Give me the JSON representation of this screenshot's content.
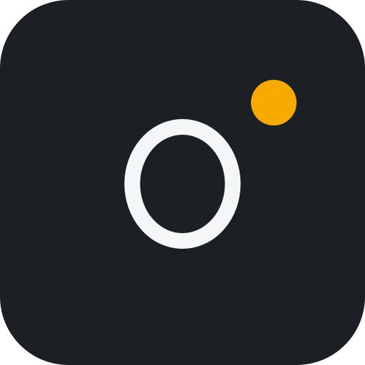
{
  "icon": {
    "name": "app-icon",
    "glyph": "O",
    "colors": {
      "background": "#1c1f24",
      "glyph": "#f5f6f8",
      "accent_dot": "#f7aa00"
    }
  }
}
